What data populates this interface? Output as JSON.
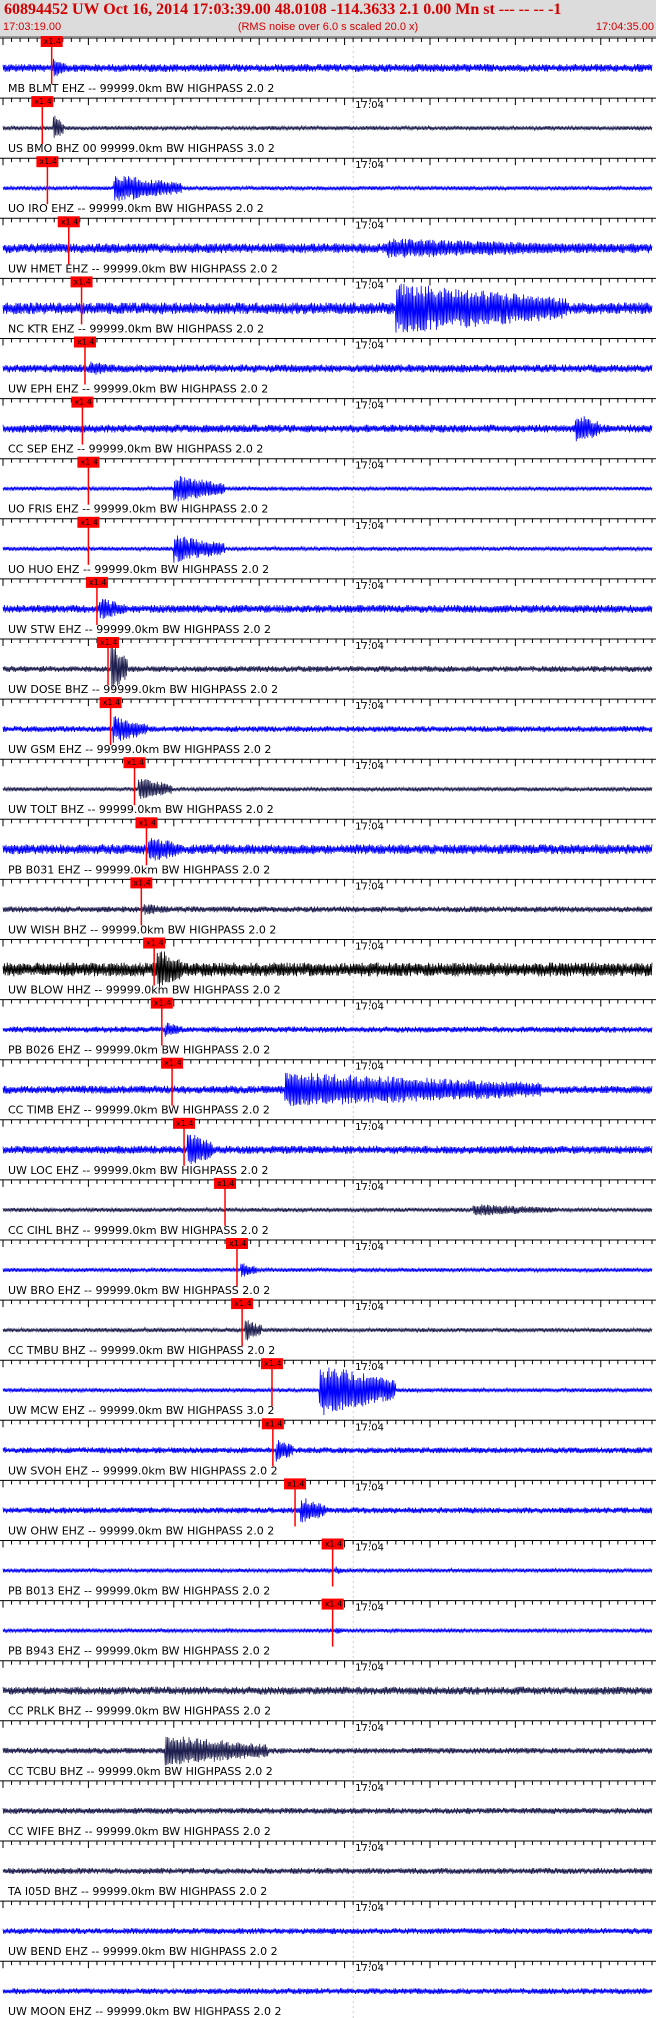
{
  "header": {
    "title": "60894452 UW Oct 16, 2014 17:03:39.00   48.0108 -114.3633  2.1 0.00 Mn st --- -- --   -1",
    "start_time": "17:03:19.00",
    "subtitle": "(RMS noise over 6.0 s scaled 20.0 x)",
    "end_time": "17:04:35.00"
  },
  "chart_data": {
    "type": "line",
    "description_scale": "RMS noise over 6.0 s scaled 20.0 x",
    "x_range_seconds": [
      0,
      76
    ],
    "minute_mark_label": "17:04",
    "minute_mark_offset_s": 41,
    "pick_label": "x1.4",
    "colors": {
      "trace": "#0000ff",
      "trace_dark": "#202050",
      "trace_black": "#000000",
      "pick": "#ff0000"
    },
    "traces": [
      {
        "label": "MB BLMT EHZ -- 99999.0km BW  HIGHPASS  2.0  2",
        "pick_s": 5.7,
        "amp": 4,
        "color": "#0000ff",
        "event": {
          "s": 5.9,
          "amp": 10,
          "dur": 1.5
        }
      },
      {
        "label": "US BMO BHZ 00 99999.0km BW  HIGHPASS  3.0  2",
        "pick_s": 4.6,
        "amp": 2,
        "color": "#202050",
        "event": {
          "s": 5.9,
          "amp": 14,
          "dur": 1.2
        }
      },
      {
        "label": "UO IRO EHZ -- 99999.0km BW  HIGHPASS  2.0  2",
        "pick_s": 5.2,
        "amp": 2,
        "color": "#0000ff",
        "event": {
          "s": 13,
          "amp": 14,
          "dur": 8
        }
      },
      {
        "label": "UW HMET EHZ -- 99999.0km BW  HIGHPASS  2.0  2",
        "pick_s": 7.7,
        "amp": 5,
        "color": "#0000ff",
        "event": {
          "s": 45,
          "amp": 10,
          "dur": 25
        }
      },
      {
        "label": "NC KTR EHZ -- 99999.0km BW  HIGHPASS  2.0  2",
        "pick_s": 9.2,
        "amp": 6,
        "color": "#0000ff",
        "event": {
          "s": 46,
          "amp": 26,
          "dur": 20
        }
      },
      {
        "label": "UW EPH EHZ -- 99999.0km BW  HIGHPASS  2.0  2",
        "pick_s": 9.6,
        "amp": 4,
        "color": "#0000ff",
        "event": {
          "s": 10,
          "amp": 8,
          "dur": 3
        }
      },
      {
        "label": "CC SEP EHZ -- 99999.0km BW  HIGHPASS  2.0  2",
        "pick_s": 9.3,
        "amp": 4,
        "color": "#0000ff",
        "event": {
          "s": 67,
          "amp": 16,
          "dur": 3
        }
      },
      {
        "label": "UO FRIS EHZ -- 99999.0km BW  HIGHPASS  2.0  2",
        "pick_s": 10,
        "amp": 2,
        "color": "#0000ff",
        "event": {
          "s": 20,
          "amp": 14,
          "dur": 6
        }
      },
      {
        "label": "UO HUO EHZ -- 99999.0km BW  HIGHPASS  2.0  2",
        "pick_s": 10,
        "amp": 2,
        "color": "#0000ff",
        "event": {
          "s": 20,
          "amp": 14,
          "dur": 6
        }
      },
      {
        "label": "UW STW EHZ -- 99999.0km BW  HIGHPASS  2.0  2",
        "pick_s": 11,
        "amp": 4,
        "color": "#0000ff",
        "event": {
          "s": 11.3,
          "amp": 12,
          "dur": 3
        }
      },
      {
        "label": "UW DOSE BHZ -- 99999.0km BW  HIGHPASS  2.0  2",
        "pick_s": 12.3,
        "amp": 3,
        "color": "#202050",
        "event": {
          "s": 12.6,
          "amp": 26,
          "dur": 2
        }
      },
      {
        "label": "UW GSM EHZ -- 99999.0km BW  HIGHPASS  2.0  2",
        "pick_s": 12.6,
        "amp": 3,
        "color": "#0000ff",
        "event": {
          "s": 12.9,
          "amp": 14,
          "dur": 4
        }
      },
      {
        "label": "UW TOLT BHZ -- 99999.0km BW  HIGHPASS  2.0  2",
        "pick_s": 15.4,
        "amp": 2,
        "color": "#202050",
        "event": {
          "s": 15.8,
          "amp": 12,
          "dur": 4
        }
      },
      {
        "label": "PB B031 EHZ -- 99999.0km BW  HIGHPASS  2.0  2",
        "pick_s": 16.8,
        "amp": 5,
        "color": "#0000ff",
        "event": {
          "s": 17,
          "amp": 14,
          "dur": 4
        }
      },
      {
        "label": "UW WISH BHZ -- 99999.0km BW  HIGHPASS  2.0  2",
        "pick_s": 16.2,
        "amp": 3,
        "color": "#202050",
        "event": {
          "s": 16.5,
          "amp": 6,
          "dur": 3
        }
      },
      {
        "label": "UW BLOW HHZ -- 99999.0km BW  HIGHPASS  2.0  2",
        "pick_s": 17.7,
        "amp": 7,
        "color": "#000000",
        "event": {
          "s": 18,
          "amp": 22,
          "dur": 3
        }
      },
      {
        "label": "PB B026 EHZ -- 99999.0km BW  HIGHPASS  2.0  2",
        "pick_s": 18.6,
        "amp": 3,
        "color": "#0000ff",
        "event": {
          "s": 19,
          "amp": 8,
          "dur": 2
        }
      },
      {
        "label": "CC TIMB EHZ -- 99999.0km BW  HIGHPASS  2.0  2",
        "pick_s": 19.8,
        "amp": 4,
        "color": "#0000ff",
        "event": {
          "s": 33,
          "amp": 18,
          "dur": 30
        }
      },
      {
        "label": "UW LOC EHZ -- 99999.0km BW  HIGHPASS  2.0  2",
        "pick_s": 21.2,
        "amp": 4,
        "color": "#0000ff",
        "event": {
          "s": 21.6,
          "amp": 18,
          "dur": 3
        }
      },
      {
        "label": "CC CIHL BHZ -- 99999.0km BW  HIGHPASS  2.0  2",
        "pick_s": 26,
        "amp": 2,
        "color": "#202050",
        "event": {
          "s": 55,
          "amp": 6,
          "dur": 10
        }
      },
      {
        "label": "UW BRO EHZ -- 99999.0km BW  HIGHPASS  2.0  2",
        "pick_s": 27.4,
        "amp": 2,
        "color": "#0000ff",
        "event": {
          "s": 27.8,
          "amp": 8,
          "dur": 2
        }
      },
      {
        "label": "CC TMBU BHZ -- 99999.0km BW  HIGHPASS  2.0  2",
        "pick_s": 28,
        "amp": 2,
        "color": "#202050",
        "event": {
          "s": 28.3,
          "amp": 12,
          "dur": 2
        }
      },
      {
        "label": "UW MCW EHZ -- 99999.0km BW  HIGHPASS  3.0  2",
        "pick_s": 31.5,
        "amp": 2,
        "color": "#0000ff",
        "event": {
          "s": 37,
          "amp": 26,
          "dur": 9
        }
      },
      {
        "label": "UW SVOH EHZ -- 99999.0km BW  HIGHPASS  2.0  2",
        "pick_s": 31.6,
        "amp": 3,
        "color": "#0000ff",
        "event": {
          "s": 32,
          "amp": 12,
          "dur": 2
        }
      },
      {
        "label": "UW OHW EHZ -- 99999.0km BW  HIGHPASS  2.0  2",
        "pick_s": 34.2,
        "amp": 3,
        "color": "#0000ff",
        "event": {
          "s": 34.8,
          "amp": 14,
          "dur": 3
        }
      },
      {
        "label": "PB B013 EHZ -- 99999.0km BW  HIGHPASS  2.0  2",
        "pick_s": 38.6,
        "amp": 2,
        "color": "#0000ff",
        "event": {
          "s": 39,
          "amp": 4,
          "dur": 1
        }
      },
      {
        "label": "PB B943 EHZ -- 99999.0km BW  HIGHPASS  2.0  2",
        "pick_s": 38.6,
        "amp": 2,
        "color": "#0000ff",
        "event": {
          "s": 39,
          "amp": 4,
          "dur": 1
        }
      },
      {
        "label": "CC PRLK BHZ -- 99999.0km BW  HIGHPASS  2.0  2",
        "pick_s": null,
        "amp": 4,
        "color": "#202050",
        "event": null
      },
      {
        "label": "CC TCBU BHZ -- 99999.0km BW  HIGHPASS  2.0  2",
        "pick_s": null,
        "amp": 3,
        "color": "#202050",
        "event": {
          "s": 19,
          "amp": 16,
          "dur": 12
        }
      },
      {
        "label": "CC WIFE BHZ -- 99999.0km BW  HIGHPASS  2.0  2",
        "pick_s": null,
        "amp": 3,
        "color": "#202050",
        "event": null
      },
      {
        "label": "TA I05D BHZ -- 99999.0km BW  HIGHPASS  2.0  2",
        "pick_s": null,
        "amp": 3,
        "color": "#202050",
        "event": null
      },
      {
        "label": "UW BEND EHZ -- 99999.0km BW  HIGHPASS  2.0  2",
        "pick_s": null,
        "amp": 3,
        "color": "#0000ff",
        "event": null
      },
      {
        "label": "UW MOON EHZ -- 99999.0km BW  HIGHPASS  2.0  2",
        "pick_s": null,
        "amp": 3,
        "color": "#0000ff",
        "event": null
      }
    ]
  }
}
